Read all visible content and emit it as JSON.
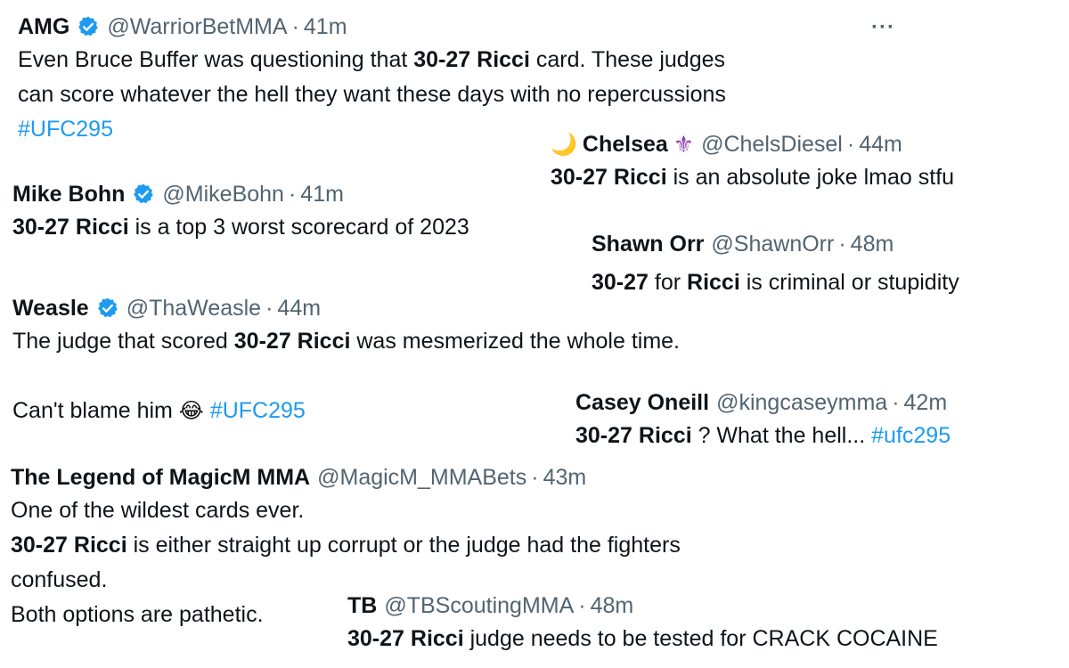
{
  "tweets": {
    "amg": {
      "name": "AMG",
      "handle": "@WarriorBetMMA",
      "sep": "·",
      "time": "41m",
      "line1_pre": "Even Bruce Buffer was questioning that ",
      "line1_bold": "30-27 Ricci",
      "line1_post": " card. These judges",
      "line2": "can score whatever the hell they want these days with no repercussions",
      "hashtag": "#UFC295",
      "more": "···"
    },
    "chelsea": {
      "name": "Chelsea",
      "handle": "@ChelsDiesel",
      "sep": "·",
      "time": "44m",
      "moon_emoji": "🌙",
      "fleur_emoji": "⚜",
      "bold": "30-27 Ricci",
      "post": " is an absolute joke lmao stfu"
    },
    "mike": {
      "name": "Mike Bohn",
      "handle": "@MikeBohn",
      "sep": "·",
      "time": "41m",
      "bold": "30-27 Ricci",
      "post": " is a top 3 worst scorecard of 2023"
    },
    "shawn": {
      "name": "Shawn Orr",
      "handle": "@ShawnOrr",
      "sep": "·",
      "time": "48m",
      "bold1": "30-27",
      "mid": " for ",
      "bold2": "Ricci",
      "post": " is criminal or stupidity"
    },
    "weasle": {
      "name": "Weasle",
      "handle": "@ThaWeasle",
      "sep": "·",
      "time": "44m",
      "line1_pre": "The judge that scored ",
      "line1_bold": "30-27 Ricci",
      "line1_post": " was mesmerized the whole time.",
      "line2_pre": "Can't blame him ",
      "emoji": "😂",
      "hashtag": "#UFC295"
    },
    "casey": {
      "name": "Casey Oneill",
      "handle": "@kingcaseymma",
      "sep": "·",
      "time": "42m",
      "bold": "30-27 Ricci",
      "post": " ? What the hell... ",
      "hashtag": "#ufc295"
    },
    "magic": {
      "name": "The Legend of MagicM MMA",
      "handle": "@MagicM_MMABets",
      "sep": "·",
      "time": "43m",
      "line1": "One of the wildest cards ever.",
      "line2_bold": "30-27 Ricci",
      "line2_post": " is either straight up corrupt or the judge had the fighters",
      "line3": "confused.",
      "line4": "Both options are pathetic."
    },
    "tb": {
      "name": "TB",
      "handle": "@TBScoutingMMA",
      "sep": "·",
      "time": "48m",
      "bold": "30-27 Ricci",
      "post": " judge needs to be tested for CRACK COCAINE"
    }
  },
  "colors": {
    "text": "#0f1419",
    "secondary": "#536471",
    "link": "#1d9bf0",
    "verified": "#1d9bf0"
  }
}
